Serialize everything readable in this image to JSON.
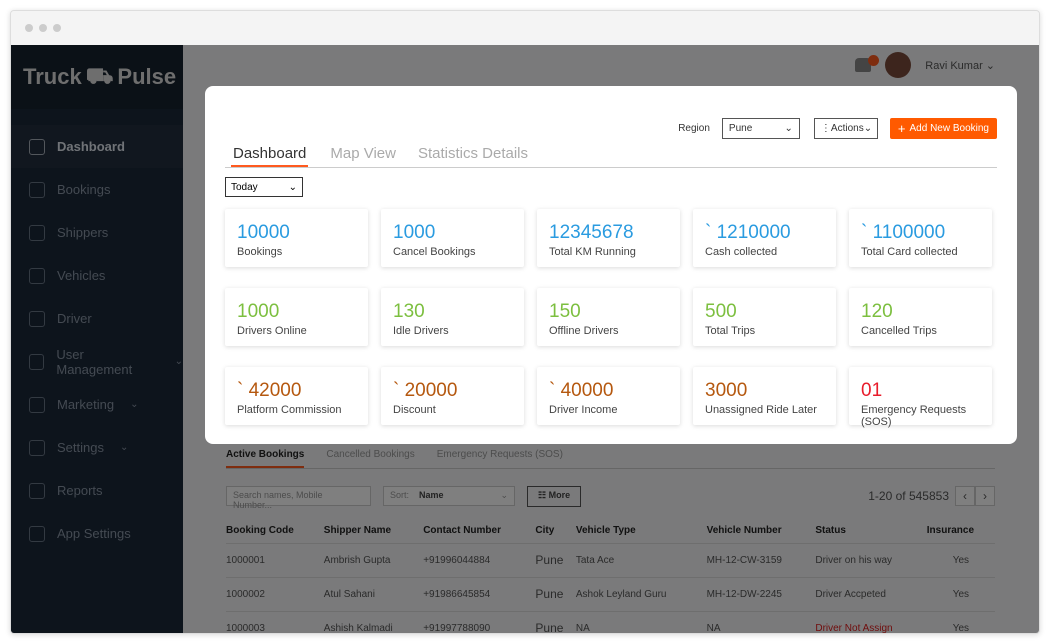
{
  "colors": {
    "accent": "#ff5a00",
    "blue": "#2a9be0",
    "green": "#7cbf3f",
    "brown": "#b5580f",
    "red": "#e81c2b"
  },
  "app": {
    "logo_text_1": "Truck",
    "logo_text_2": "Pulse"
  },
  "sidebar": {
    "items": [
      {
        "label": "Dashboard",
        "icon": "home-icon",
        "active": true
      },
      {
        "label": "Bookings",
        "icon": "clipboard-icon"
      },
      {
        "label": "Shippers",
        "icon": "user-icon"
      },
      {
        "label": "Vehicles",
        "icon": "truck-icon"
      },
      {
        "label": "Driver",
        "icon": "driver-icon"
      },
      {
        "label": "User Management",
        "icon": "users-icon",
        "chevron": "⌄"
      },
      {
        "label": "Marketing",
        "icon": "megaphone-icon",
        "chevron": "⌄"
      },
      {
        "label": "Settings",
        "icon": "gear-icon",
        "chevron": "⌄"
      },
      {
        "label": "Reports",
        "icon": "chart-icon"
      },
      {
        "label": "App Settings",
        "icon": "phone-icon"
      }
    ]
  },
  "topbar": {
    "user": "Ravi Kumar ⌄"
  },
  "modal": {
    "region_label": "Region",
    "region_value": "Pune",
    "actions_label": "Actions",
    "add_label": "Add New Booking",
    "tabs": [
      "Dashboard",
      "Map View",
      "Statistics Details"
    ],
    "period": "Today",
    "cards": [
      {
        "value": "10000",
        "label": "Bookings",
        "color": "blue"
      },
      {
        "value": "1000",
        "label": "Cancel Bookings",
        "color": "blue"
      },
      {
        "value": "12345678",
        "label": "Total KM Running",
        "color": "blue"
      },
      {
        "value": "` 1210000",
        "label": "Cash collected",
        "color": "blue"
      },
      {
        "value": "` 1100000",
        "label": "Total Card collected",
        "color": "blue"
      },
      {
        "value": "1000",
        "label": "Drivers Online",
        "color": "green"
      },
      {
        "value": "130",
        "label": "Idle Drivers",
        "color": "green"
      },
      {
        "value": "150",
        "label": "Offline Drivers",
        "color": "green"
      },
      {
        "value": "500",
        "label": "Total Trips",
        "color": "green"
      },
      {
        "value": "120",
        "label": "Cancelled Trips",
        "color": "green"
      },
      {
        "value": "` 42000",
        "label": "Platform Commission",
        "color": "brown"
      },
      {
        "value": "` 20000",
        "label": "Discount",
        "color": "brown"
      },
      {
        "value": "` 40000",
        "label": "Driver Income",
        "color": "brown"
      },
      {
        "value": "3000",
        "label": "Unassigned Ride Later",
        "color": "brown"
      },
      {
        "value": "01",
        "label": "Emergency Requests (SOS)",
        "color": "red"
      }
    ]
  },
  "bookings": {
    "tabs": [
      "Active Bookings",
      "Cancelled Bookings",
      "Emergency Requests (SOS)"
    ],
    "search_placeholder": "Search names, Mobile Number...",
    "sort_label": "Sort:",
    "sort_value": "Name",
    "more_label": "More",
    "pagination": "1-20  of  545853",
    "columns": [
      "Booking Code",
      "Shipper Name",
      "Contact Number",
      "City",
      "Vehicle Type",
      "Vehicle Number",
      "Status",
      "Insurance"
    ],
    "rows": [
      [
        "1000001",
        "Ambrish Gupta",
        "+91996044884",
        "Pune",
        "Tata Ace",
        "MH-12-CW-3159",
        "Driver on his way",
        "Yes"
      ],
      [
        "1000002",
        "Atul Sahani",
        "+91986645854",
        "Pune",
        "Ashok Leyland Guru",
        "MH-12-DW-2245",
        "Driver Accpeted",
        "Yes"
      ],
      [
        "1000003",
        "Ashish Kalmadi",
        "+91997788090",
        "Pune",
        "NA",
        "NA",
        "Driver Not Assign",
        "Yes"
      ]
    ]
  }
}
